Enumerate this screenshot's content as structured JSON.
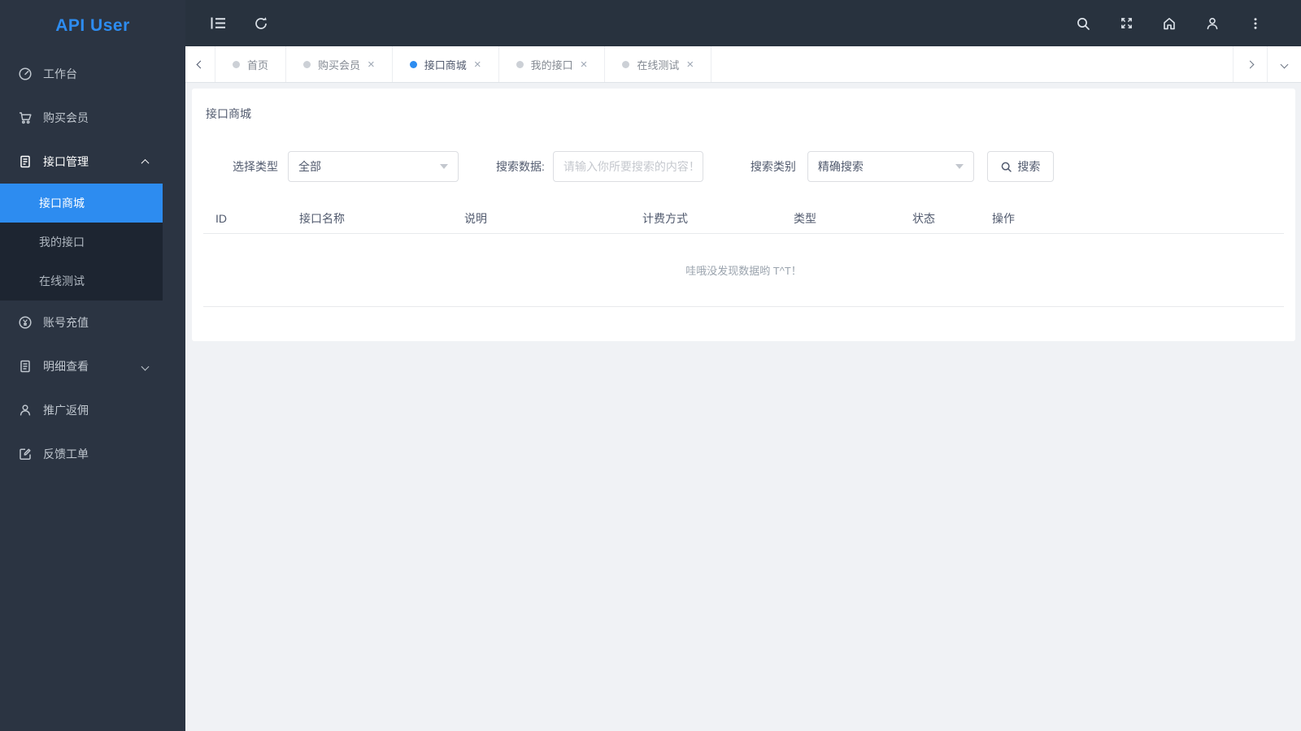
{
  "brand": {
    "title": "API User"
  },
  "colors": {
    "primary": "#2d8cf0",
    "sidebar_bg": "#2b3442",
    "submenu_bg": "#1d2531",
    "topbar_bg": "#28323e",
    "content_bg": "#f0f2f5"
  },
  "topbar": {
    "icons": [
      "menu-fold",
      "refresh",
      "search",
      "fullscreen",
      "home",
      "user",
      "more-vertical"
    ]
  },
  "sidebar": {
    "items": [
      {
        "label": "工作台",
        "icon": "dashboard"
      },
      {
        "label": "购买会员",
        "icon": "cart"
      },
      {
        "label": "接口管理",
        "icon": "api-doc",
        "state": "expanded",
        "children": [
          {
            "label": "接口商城",
            "active": true
          },
          {
            "label": "我的接口",
            "active": false
          },
          {
            "label": "在线测试",
            "active": false
          }
        ]
      },
      {
        "label": "账号充值",
        "icon": "recharge"
      },
      {
        "label": "明细查看",
        "icon": "detail-doc",
        "state": "collapsed"
      },
      {
        "label": "推广返佣",
        "icon": "referral-user"
      },
      {
        "label": "反馈工单",
        "icon": "feedback-edit"
      }
    ]
  },
  "tabs": {
    "close_glyph": "×",
    "items": [
      {
        "label": "首页",
        "closable": false,
        "active": false
      },
      {
        "label": "购买会员",
        "closable": true,
        "active": false
      },
      {
        "label": "接口商城",
        "closable": true,
        "active": true
      },
      {
        "label": "我的接口",
        "closable": true,
        "active": false
      },
      {
        "label": "在线测试",
        "closable": true,
        "active": false
      }
    ]
  },
  "page": {
    "title": "接口商城",
    "filters": {
      "type_label": "选择类型",
      "type_value": "全部",
      "search_label": "搜索数据:",
      "search_placeholder": "请输入你所要搜索的内容！",
      "category_label": "搜索类别",
      "category_value": "精确搜索",
      "search_button": "搜索"
    },
    "table": {
      "columns": [
        "ID",
        "接口名称",
        "说明",
        "计费方式",
        "类型",
        "状态",
        "操作"
      ],
      "empty_text": "哇哦没发现数据哟 T^T！"
    }
  }
}
